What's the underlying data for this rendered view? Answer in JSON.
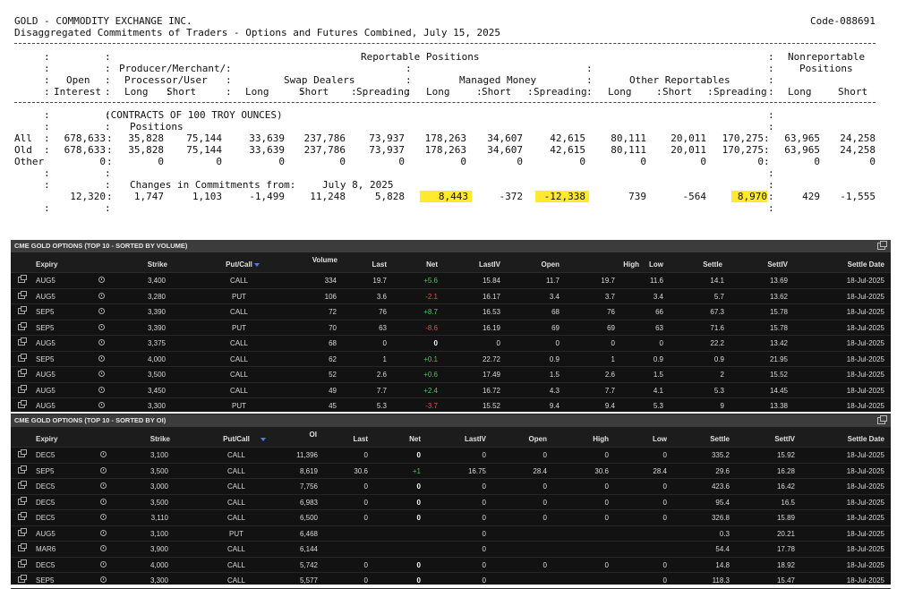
{
  "cot": {
    "title": "GOLD - COMMODITY EXCHANGE INC.",
    "code": "Code-088691",
    "subtitle": "Disaggregated Commitments of Traders - Options and Futures Combined, July 15, 2025",
    "hdr_reportable": "Reportable Positions",
    "hdr_nonreportable": "Nonreportable",
    "hdr_positions": "Positions",
    "hdr_producer": "Producer/Merchant/",
    "hdr_processor": "Processor/User",
    "hdr_swap": "Swap Dealers",
    "hdr_managed": "Managed Money",
    "hdr_other": "Other Reportables",
    "hdr_open": "Open",
    "hdr_interest": "Interest",
    "hdr_long": "Long",
    "hdr_short": "Short",
    "hdr_spreading": "Spreading",
    "contracts_note": "(CONTRACTS OF 100 TROY OUNCES)",
    "positions_label": "Positions",
    "rows": [
      {
        "label": "All",
        "values": [
          "678,633",
          "35,828",
          "75,144",
          "33,639",
          "237,786",
          "73,937",
          "178,263",
          "34,607",
          "42,615",
          "80,111",
          "20,011",
          "170,275",
          "63,965",
          "24,258"
        ]
      },
      {
        "label": "Old",
        "values": [
          "678,633",
          "35,828",
          "75,144",
          "33,639",
          "237,786",
          "73,937",
          "178,263",
          "34,607",
          "42,615",
          "80,111",
          "20,011",
          "170,275",
          "63,965",
          "24,258"
        ]
      },
      {
        "label": "Other",
        "values": [
          "0",
          "0",
          "0",
          "0",
          "0",
          "0",
          "0",
          "0",
          "0",
          "0",
          "0",
          "0",
          "0",
          "0"
        ]
      }
    ],
    "changes_label": "Changes in Commitments from:",
    "changes_date": "July 8, 2025",
    "changes": [
      "12,320",
      "1,747",
      "1,103",
      "-1,499",
      "11,248",
      "5,828",
      "8,443",
      "-372",
      "-12,338",
      "739",
      "-564",
      "8,970",
      "429",
      "-1,555"
    ],
    "highlight_color": "#ffea2e"
  },
  "vol_panel": {
    "title": "CME GOLD OPTIONS (TOP 10 - SORTED BY VOLUME)",
    "headers": {
      "expiry": "Expiry",
      "strike": "Strike",
      "putcall": "Put/Call",
      "metric": "Volume",
      "last": "Last",
      "net": "Net",
      "lastiv": "LastIV",
      "open": "Open",
      "high": "High",
      "low": "Low",
      "settle": "Settle",
      "settiv": "SettIV",
      "settledate": "Settle Date"
    },
    "rows": [
      {
        "expiry": "AUG5",
        "strike": "3,400",
        "pc": "CALL",
        "metric": "334",
        "last": "19.7",
        "net": "+5.6",
        "lastiv": "15.84",
        "open": "11.7",
        "high": "19.7",
        "low": "11.6",
        "settle": "14.1",
        "settiv": "13.69",
        "date": "18-Jul-2025"
      },
      {
        "expiry": "AUG5",
        "strike": "3,280",
        "pc": "PUT",
        "metric": "106",
        "last": "3.6",
        "net": "-2.1",
        "lastiv": "16.17",
        "open": "3.4",
        "high": "3.7",
        "low": "3.4",
        "settle": "5.7",
        "settiv": "13.62",
        "date": "18-Jul-2025"
      },
      {
        "expiry": "SEP5",
        "strike": "3,390",
        "pc": "CALL",
        "metric": "72",
        "last": "76",
        "net": "+8.7",
        "lastiv": "16.53",
        "open": "68",
        "high": "76",
        "low": "66",
        "settle": "67.3",
        "settiv": "15.78",
        "date": "18-Jul-2025"
      },
      {
        "expiry": "SEP5",
        "strike": "3,390",
        "pc": "PUT",
        "metric": "70",
        "last": "63",
        "net": "-8.6",
        "lastiv": "16.19",
        "open": "69",
        "high": "69",
        "low": "63",
        "settle": "71.6",
        "settiv": "15.78",
        "date": "18-Jul-2025"
      },
      {
        "expiry": "AUG5",
        "strike": "3,375",
        "pc": "CALL",
        "metric": "68",
        "last": "0",
        "net": "0",
        "lastiv": "0",
        "open": "0",
        "high": "0",
        "low": "0",
        "settle": "22.2",
        "settiv": "13.42",
        "date": "18-Jul-2025"
      },
      {
        "expiry": "SEP5",
        "strike": "4,000",
        "pc": "CALL",
        "metric": "62",
        "last": "1",
        "net": "+0.1",
        "lastiv": "22.72",
        "open": "0.9",
        "high": "1",
        "low": "0.9",
        "settle": "0.9",
        "settiv": "21.95",
        "date": "18-Jul-2025"
      },
      {
        "expiry": "AUG5",
        "strike": "3,500",
        "pc": "CALL",
        "metric": "52",
        "last": "2.6",
        "net": "+0.6",
        "lastiv": "17.49",
        "open": "1.5",
        "high": "2.6",
        "low": "1.5",
        "settle": "2",
        "settiv": "15.52",
        "date": "18-Jul-2025"
      },
      {
        "expiry": "AUG5",
        "strike": "3,450",
        "pc": "CALL",
        "metric": "49",
        "last": "7.7",
        "net": "+2.4",
        "lastiv": "16.72",
        "open": "4.3",
        "high": "7.7",
        "low": "4.1",
        "settle": "5.3",
        "settiv": "14.45",
        "date": "18-Jul-2025"
      },
      {
        "expiry": "AUG5",
        "strike": "3,300",
        "pc": "PUT",
        "metric": "45",
        "last": "5.3",
        "net": "-3.7",
        "lastiv": "15.52",
        "open": "9.4",
        "high": "9.4",
        "low": "5.3",
        "settle": "9",
        "settiv": "13.38",
        "date": "18-Jul-2025"
      }
    ]
  },
  "oi_panel": {
    "title": "CME GOLD OPTIONS (TOP 10 - SORTED BY OI)",
    "headers": {
      "expiry": "Expiry",
      "strike": "Strike",
      "putcall": "Put/Call",
      "metric": "OI",
      "last": "Last",
      "net": "Net",
      "lastiv": "LastIV",
      "open": "Open",
      "high": "High",
      "low": "Low",
      "settle": "Settle",
      "settiv": "SettIV",
      "settledate": "Settle Date"
    },
    "rows": [
      {
        "expiry": "DEC5",
        "strike": "3,100",
        "pc": "CALL",
        "metric": "11,396",
        "last": "0",
        "net": "0",
        "lastiv": "0",
        "open": "0",
        "high": "0",
        "low": "0",
        "settle": "335.2",
        "settiv": "15.92",
        "date": "18-Jul-2025"
      },
      {
        "expiry": "SEP5",
        "strike": "3,500",
        "pc": "CALL",
        "metric": "8,619",
        "last": "30.6",
        "net": "+1",
        "lastiv": "16.75",
        "open": "28.4",
        "high": "30.6",
        "low": "28.4",
        "settle": "29.6",
        "settiv": "16.28",
        "date": "18-Jul-2025"
      },
      {
        "expiry": "DEC5",
        "strike": "3,000",
        "pc": "CALL",
        "metric": "7,756",
        "last": "0",
        "net": "0",
        "lastiv": "0",
        "open": "0",
        "high": "0",
        "low": "0",
        "settle": "423.6",
        "settiv": "16.42",
        "date": "18-Jul-2025"
      },
      {
        "expiry": "DEC5",
        "strike": "3,500",
        "pc": "CALL",
        "metric": "6,983",
        "last": "0",
        "net": "0",
        "lastiv": "0",
        "open": "0",
        "high": "0",
        "low": "0",
        "settle": "95.4",
        "settiv": "16.5",
        "date": "18-Jul-2025"
      },
      {
        "expiry": "DEC5",
        "strike": "3,110",
        "pc": "CALL",
        "metric": "6,500",
        "last": "0",
        "net": "0",
        "lastiv": "0",
        "open": "0",
        "high": "0",
        "low": "0",
        "settle": "326.8",
        "settiv": "15.89",
        "date": "18-Jul-2025"
      },
      {
        "expiry": "AUG5",
        "strike": "3,100",
        "pc": "PUT",
        "metric": "6,468",
        "last": "",
        "net": "",
        "lastiv": "0",
        "open": "",
        "high": "",
        "low": "",
        "settle": "0.3",
        "settiv": "20.21",
        "date": "18-Jul-2025"
      },
      {
        "expiry": "MAR6",
        "strike": "3,900",
        "pc": "CALL",
        "metric": "6,144",
        "last": "",
        "net": "",
        "lastiv": "0",
        "open": "",
        "high": "",
        "low": "",
        "settle": "54.4",
        "settiv": "17.78",
        "date": "18-Jul-2025"
      },
      {
        "expiry": "DEC5",
        "strike": "4,000",
        "pc": "CALL",
        "metric": "5,742",
        "last": "0",
        "net": "0",
        "lastiv": "0",
        "open": "0",
        "high": "0",
        "low": "0",
        "settle": "14.8",
        "settiv": "18.92",
        "date": "18-Jul-2025"
      },
      {
        "expiry": "SEP5",
        "strike": "3,300",
        "pc": "CALL",
        "metric": "5,577",
        "last": "0",
        "net": "0",
        "lastiv": "0",
        "open": "",
        "high": "",
        "low": "0",
        "settle": "118.3",
        "settiv": "15.47",
        "date": "18-Jul-2025"
      }
    ]
  },
  "colors": {
    "positive": "#3ccf4e",
    "negative": "#f04a4a",
    "panel_bg": "#121212",
    "panel_header": "#3c3c3c"
  }
}
